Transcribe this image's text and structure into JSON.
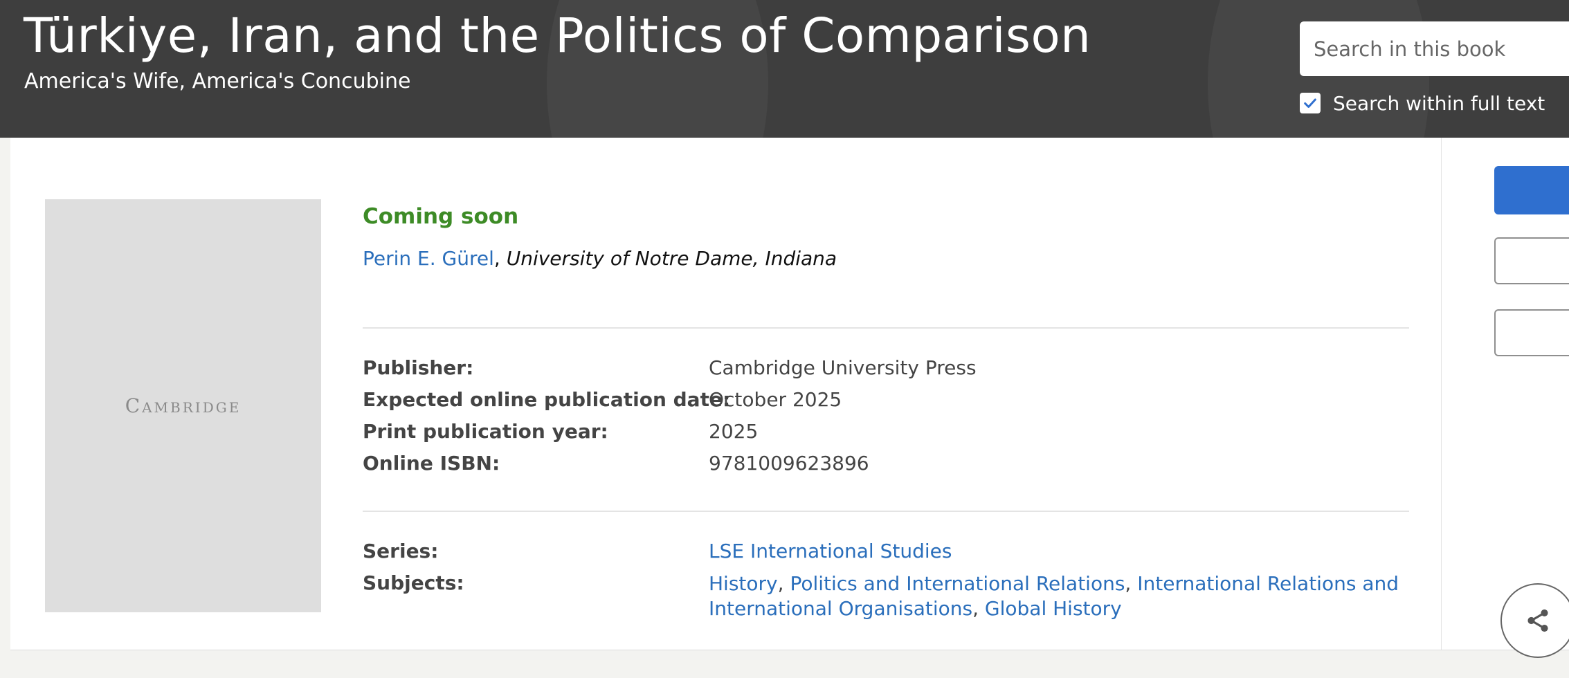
{
  "header": {
    "title": "Türkiye, Iran, and the Politics of Comparison",
    "subtitle": "America's Wife, America's Concubine",
    "search_placeholder": "Search in this book",
    "fulltext_label": "Search within full text",
    "fulltext_checked": true
  },
  "book": {
    "cover_logo": "Cambridge",
    "status": "Coming soon",
    "author_name": "Perin E. Gürel",
    "author_separator": ", ",
    "affiliation": "University of Notre Dame, Indiana"
  },
  "details": [
    {
      "label": "Publisher:",
      "value": "Cambridge University Press"
    },
    {
      "label": "Expected online publication date:",
      "value": "October 2025"
    },
    {
      "label": "Print publication year:",
      "value": "2025"
    },
    {
      "label": "Online ISBN:",
      "value": "9781009623896"
    }
  ],
  "series": {
    "label": "Series:",
    "value": "LSE International Studies"
  },
  "subjects": {
    "label": "Subjects:",
    "items": [
      "History",
      "Politics and International Relations",
      "International Relations and International Organisations",
      "Global History"
    ],
    "separator": ", "
  },
  "icons": {
    "checkbox": "check-icon",
    "share": "share-icon"
  },
  "colors": {
    "header_bg": "#3e3e3e",
    "status_green": "#3d8b26",
    "link_blue": "#2a6ebb",
    "primary_button": "#2f6fcf"
  }
}
